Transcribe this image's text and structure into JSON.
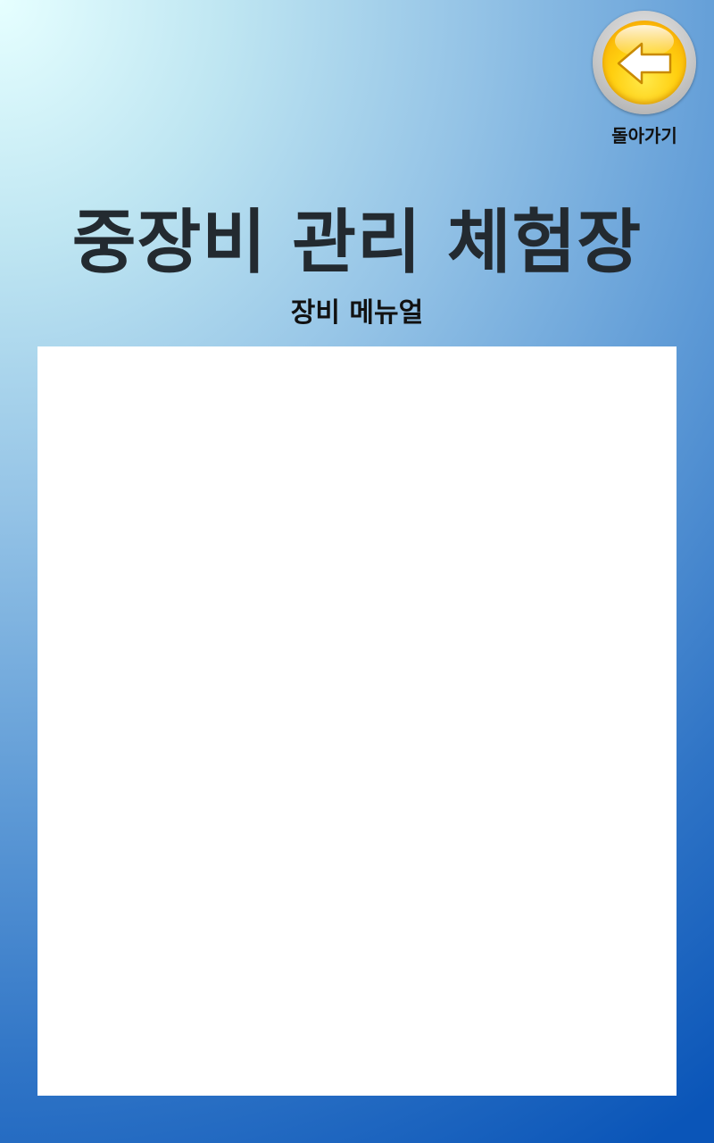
{
  "header": {
    "back_button_label": "돌아가기",
    "back_icon": "back-arrow-icon",
    "title": "중장비 관리 체험장",
    "subtitle": "장비 메뉴얼"
  },
  "colors": {
    "background_top_left": "#e6ffff",
    "background_bottom_right": "#0a55b8",
    "title_text": "#232a30",
    "button_yellow": "#ffcf10",
    "panel": "#ffffff"
  }
}
